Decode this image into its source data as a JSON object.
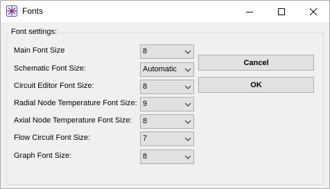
{
  "window": {
    "title": "Fonts",
    "app_icon": "snowflake-app-icon",
    "controls": [
      "minimize-icon",
      "maximize-icon",
      "close-icon"
    ]
  },
  "group": {
    "title": "Font settings:"
  },
  "settings": [
    {
      "label": "Main Font Size",
      "value": "8"
    },
    {
      "label": "Schematic Font Size:",
      "value": "Automatic"
    },
    {
      "label": "Circuit Editor Font Size:",
      "value": "8"
    },
    {
      "label": "Radial Node Temperature Font Size:",
      "value": "9"
    },
    {
      "label": "Axial Node Temperature Font Size:",
      "value": "8"
    },
    {
      "label": "Flow Circuit Font Size:",
      "value": "7"
    },
    {
      "label": "Graph Font Size:",
      "value": "8"
    }
  ],
  "buttons": {
    "cancel": "Cancel",
    "ok": "OK"
  },
  "colors": {
    "window_bg": "#f0f0f0",
    "titlebar_bg": "#ffffff",
    "control_bg": "#e1e1e1",
    "control_border": "#adadad",
    "app_icon": "#5a3fb0"
  }
}
